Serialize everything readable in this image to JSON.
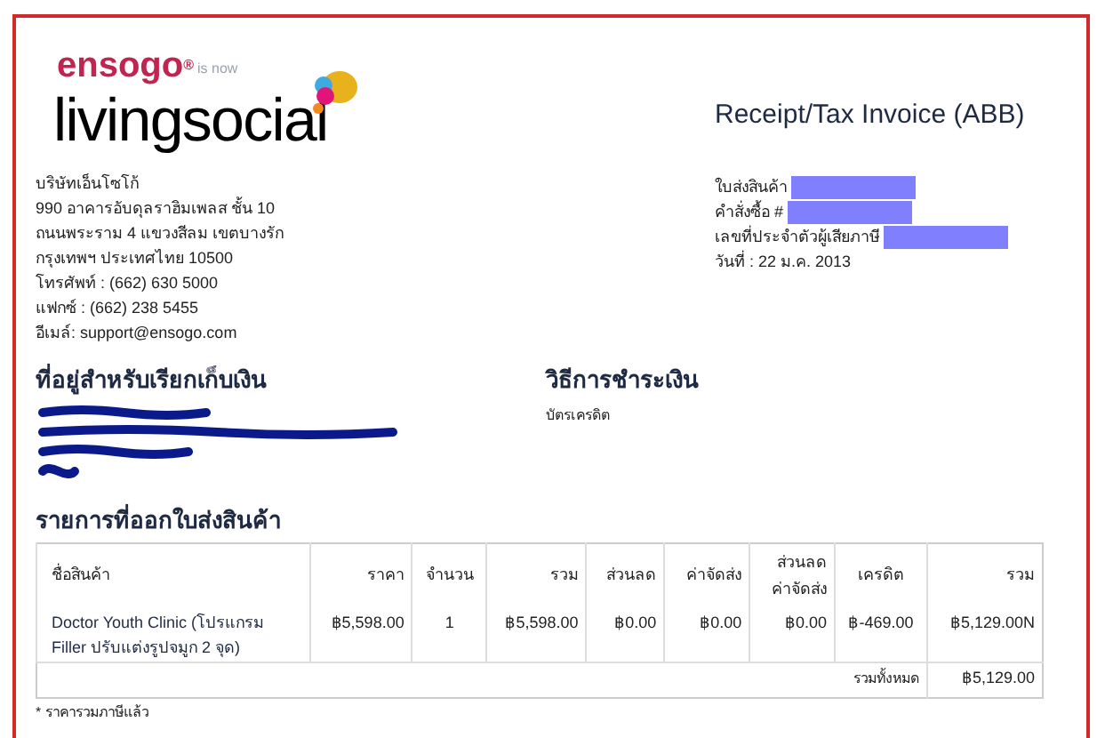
{
  "logo": {
    "old_brand": "ensogo$^{®}$",
    "transition": "is now",
    "new_brand": "livingsocial"
  },
  "company": {
    "lines": [
      "บริษัทเอ็นโซโก้",
      "990 อาคารอับดุลราฮิมเพลส ชั้น 10",
      "ถนนพระราม 4 แขวงสีลม เขตบางรัก",
      "กรุงเทพฯ ประเทศไทย 10500",
      "โทรศัพท์ : (662) 630 5000",
      "แฟกซ์ : (662) 238 5455",
      "อีเมล์: support@ensogo.com"
    ]
  },
  "document_title": "Receipt/Tax Invoice (ABB)",
  "invoice_info": [
    {
      "label": "ใบส่งสินค้า",
      "redacted": true
    },
    {
      "label": "คำสั่งซื้อ #",
      "redacted": true
    },
    {
      "label": "เลขที่ประจำตัวผู้เสียภาษี",
      "redacted": true
    },
    {
      "label": "วันที่ : 22 ม.ค. 2013",
      "redacted": false
    }
  ],
  "billing": {
    "heading": "ที่อยู่สำหรับเรียกเก็บเงิน"
  },
  "payment": {
    "heading": "วิธีการชำระเงิน",
    "method": "บัตรเครดิต"
  },
  "items": {
    "heading": "รายการที่ออกใบส่งสินค้า",
    "columns": [
      "ชื่อสินค้า",
      "ราคา",
      "จำนวน",
      "รวม",
      "ส่วนลด",
      "ค่าจัดส่ง",
      "ส่วนลดค่าจัดส่ง",
      "เครดิต",
      "รวม"
    ],
    "rows": [
      [
        "Doctor Youth Clinic (โปรแกรม Filler ปรับแต่งรูปจมูก 2 จุด)",
        "฿5,598.00",
        "1",
        "฿5,598.00",
        "฿0.00",
        "฿0.00",
        "฿0.00",
        "฿-469.00",
        "฿5,129.00N"
      ]
    ],
    "total_label": "รวมทั้งหมด",
    "total_value": "฿5,129.00"
  },
  "footnote": "* ราคารวมภาษีแล้ว"
}
